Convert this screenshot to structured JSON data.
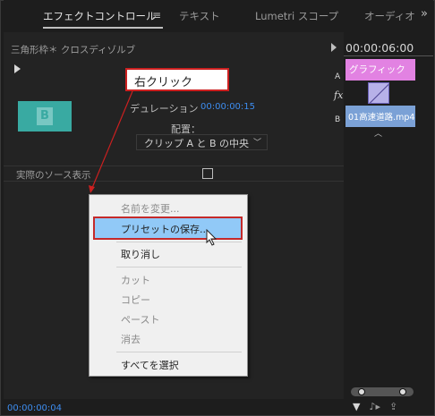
{
  "tabs": [
    {
      "label": "エフェクトコントロール",
      "active": true
    },
    {
      "label": "テキスト",
      "active": false
    },
    {
      "label": "Lumetri スコープ",
      "active": false
    },
    {
      "label": "オーディオ",
      "active": false
    }
  ],
  "tab_menu_icon": "hamburger-icon",
  "tab_more_icon": "double-chevron-right-icon",
  "panel": {
    "clip_name": "三角形枠＊ クロスディゾルブ",
    "duration_label": "デュレーション",
    "duration_value": "00:00:00:15",
    "alignment_label": "配置：",
    "alignment_value": "クリップ A と B の中央",
    "source_label": "実際のソース表示",
    "source_checked": false,
    "thumbnail_letter": "B",
    "timecode": "00:00:00:04"
  },
  "timeline": {
    "ruler_time": "00:00:06:00",
    "track_a_label": "A",
    "track_b_label": "B",
    "fx_label": "fx",
    "clip_a_name": "グラフィック",
    "clip_b_name": "01高速道路.mp4",
    "clip_a_color": "#e282e2",
    "clip_b_color": "#7ba1d6",
    "transition_color": "#b7b1e8"
  },
  "callout": {
    "text": "右クリック",
    "border_color": "#cc2020"
  },
  "context_menu": {
    "items": [
      {
        "label": "名前を変更...",
        "enabled": false
      },
      {
        "label": "プリセットの保存...",
        "enabled": true,
        "highlighted": true
      },
      {
        "label": "取り消し",
        "enabled": true
      },
      {
        "label": "カット",
        "enabled": false
      },
      {
        "label": "コピー",
        "enabled": false
      },
      {
        "label": "ペースト",
        "enabled": false
      },
      {
        "label": "消去",
        "enabled": false
      },
      {
        "label": "すべてを選択",
        "enabled": true
      }
    ]
  }
}
